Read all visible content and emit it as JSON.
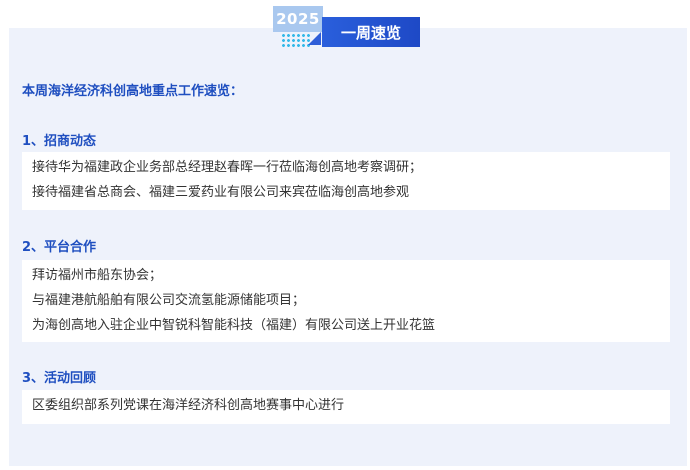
{
  "header": {
    "year": "2025",
    "title": "一周速览"
  },
  "intro": "本周海洋经济科创高地重点工作速览：",
  "sections": [
    {
      "title": "1、招商动态",
      "items": [
        "接待华为福建政企业务部总经理赵春晖一行莅临海创高地考察调研；",
        "接待福建省总商会、福建三爱药业有限公司来宾莅临海创高地参观"
      ]
    },
    {
      "title": "2、平台合作",
      "items": [
        "拜访福州市船东协会；",
        "与福建港航船舶有限公司交流氢能源储能项目；",
        "为海创高地入驻企业中智锐科智能科技（福建）有限公司送上开业花篮"
      ]
    },
    {
      "title": "3、活动回顾",
      "items": [
        "区委组织部系列党课在海洋经济科创高地赛事中心进行"
      ]
    }
  ],
  "colors": {
    "panel_bg": "#eef2fb",
    "accent": "#1f4fc0",
    "year_tag": "#a9c8ef",
    "text": "#333333"
  }
}
